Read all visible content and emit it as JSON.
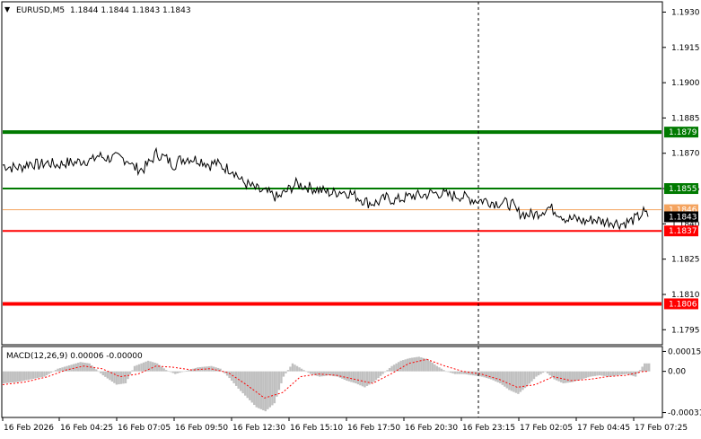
{
  "header": {
    "symbol_label": "EURUSD,M5",
    "ohlc": "1.1844 1.1844 1.1843 1.1843"
  },
  "colors": {
    "price_line": "#000000",
    "support_resistance_green": "#007a00",
    "support_resistance_red": "#ff0000",
    "bid_line": "#f4a460",
    "macd_histogram": "#c0c0c0",
    "macd_signal": "#ff0000",
    "axis_frame": "#000000",
    "crosshair": "#000000"
  },
  "chart_data": [
    {
      "type": "line",
      "panel": "main-price",
      "title": "EURUSD,M5",
      "ylim": [
        1.1789,
        1.1934
      ],
      "y_ticks": [
        "1.1930",
        "1.1915",
        "1.1900",
        "1.1885",
        "1.1870",
        "1.1855",
        "1.1840",
        "1.1825",
        "1.1810",
        "1.1795"
      ],
      "y_tick_values": [
        1.193,
        1.1915,
        1.19,
        1.1885,
        1.187,
        1.1855,
        1.184,
        1.1825,
        1.181,
        1.1795
      ],
      "x_labels": [
        "16 Feb 2026",
        "16 Feb 04:25",
        "16 Feb 07:05",
        "16 Feb 09:50",
        "16 Feb 12:30",
        "16 Feb 15:10",
        "16 Feb 17:50",
        "16 Feb 20:30",
        "16 Feb 23:15",
        "17 Feb 02:05",
        "17 Feb 04:45",
        "17 Feb 07:25"
      ],
      "price_points": [
        [
          0,
          1.1865
        ],
        [
          2,
          1.1864
        ],
        [
          4,
          1.1864
        ],
        [
          6,
          1.1866
        ],
        [
          8,
          1.1865
        ],
        [
          10,
          1.1866
        ],
        [
          12,
          1.1865
        ],
        [
          14,
          1.1866
        ],
        [
          16,
          1.1866
        ],
        [
          18,
          1.1867
        ],
        [
          20,
          1.1867
        ],
        [
          21,
          1.1869
        ],
        [
          23,
          1.1868
        ],
        [
          26,
          1.1868
        ],
        [
          28,
          1.1867
        ],
        [
          29,
          1.1864
        ],
        [
          31,
          1.1863
        ],
        [
          33,
          1.1867
        ],
        [
          34,
          1.187
        ],
        [
          36,
          1.1868
        ],
        [
          38,
          1.1865
        ],
        [
          39,
          1.1867
        ],
        [
          41,
          1.1868
        ],
        [
          44,
          1.1867
        ],
        [
          46,
          1.1865
        ],
        [
          47,
          1.1866
        ],
        [
          49,
          1.1864
        ],
        [
          51,
          1.1863
        ],
        [
          53,
          1.1858
        ],
        [
          55,
          1.1856
        ],
        [
          57,
          1.1854
        ],
        [
          59,
          1.1853
        ],
        [
          61,
          1.1851
        ],
        [
          63,
          1.1854
        ],
        [
          65,
          1.1857
        ],
        [
          67,
          1.1856
        ],
        [
          69,
          1.1855
        ],
        [
          71,
          1.1854
        ],
        [
          73,
          1.1853
        ],
        [
          75,
          1.1854
        ],
        [
          77,
          1.1853
        ],
        [
          79,
          1.1851
        ],
        [
          81,
          1.1849
        ],
        [
          83,
          1.1849
        ],
        [
          85,
          1.1851
        ],
        [
          87,
          1.185
        ],
        [
          89,
          1.1851
        ],
        [
          91,
          1.1852
        ],
        [
          93,
          1.1852
        ],
        [
          95,
          1.1853
        ],
        [
          97,
          1.1853
        ],
        [
          99,
          1.1852
        ],
        [
          101,
          1.1852
        ],
        [
          103,
          1.1851
        ],
        [
          105,
          1.185
        ],
        [
          107,
          1.185
        ],
        [
          109,
          1.1849
        ],
        [
          111,
          1.1849
        ],
        [
          113,
          1.1848
        ],
        [
          114,
          1.1845
        ],
        [
          116,
          1.1844
        ],
        [
          118,
          1.1844
        ],
        [
          119,
          1.1845
        ],
        [
          121,
          1.1847
        ],
        [
          123,
          1.1845
        ],
        [
          125,
          1.1842
        ],
        [
          127,
          1.1842
        ],
        [
          129,
          1.1841
        ],
        [
          131,
          1.1842
        ],
        [
          133,
          1.1841
        ],
        [
          135,
          1.1841
        ],
        [
          137,
          1.184
        ],
        [
          139,
          1.1841
        ],
        [
          141,
          1.1843
        ],
        [
          142,
          1.1845
        ],
        [
          143,
          1.1843
        ]
      ],
      "horizontal_levels": [
        {
          "value": 1.1879,
          "label": "1.1879",
          "color": "#007a00",
          "weight": "thick"
        },
        {
          "value": 1.1855,
          "label": "1.1855",
          "color": "#007a00",
          "weight": "thin"
        },
        {
          "value": 1.1846,
          "label": "1.1846",
          "color": "#f4a460",
          "weight": "hair"
        },
        {
          "value": 1.1843,
          "label": "1.1843",
          "color": "#000000",
          "weight": "current"
        },
        {
          "value": 1.1837,
          "label": "1.1837",
          "color": "#ff0000",
          "weight": "thin"
        },
        {
          "value": 1.1806,
          "label": "1.1806",
          "color": "#ff0000",
          "weight": "thick"
        }
      ],
      "grid": false
    },
    {
      "type": "bar",
      "panel": "macd",
      "title": "MACD(12,26,9) 0.00006 -0.00000",
      "ylim": [
        -0.00034,
        0.00018
      ],
      "y_ticks": [
        "0.00015",
        "0.00",
        "-0.00031"
      ],
      "y_tick_values": [
        0.00015,
        0.0,
        -0.00031
      ],
      "macd_points": [
        [
          0,
          -9e-05
        ],
        [
          3,
          -8e-05
        ],
        [
          6,
          -6e-05
        ],
        [
          9,
          -4e-05
        ],
        [
          12,
          2e-05
        ],
        [
          15,
          5e-05
        ],
        [
          17,
          7e-05
        ],
        [
          19,
          6e-05
        ],
        [
          22,
          -3e-05
        ],
        [
          25,
          -0.0001
        ],
        [
          27,
          -9e-05
        ],
        [
          29,
          4e-05
        ],
        [
          32,
          8e-05
        ],
        [
          34,
          6e-05
        ],
        [
          36,
          1e-05
        ],
        [
          38,
          -2e-05
        ],
        [
          40,
          0.0
        ],
        [
          43,
          3e-05
        ],
        [
          46,
          4e-05
        ],
        [
          48,
          2e-05
        ],
        [
          50,
          -5e-05
        ],
        [
          52,
          -0.00013
        ],
        [
          54,
          -0.0002
        ],
        [
          56,
          -0.00027
        ],
        [
          58,
          -0.0003
        ],
        [
          60,
          -0.00024
        ],
        [
          62,
          -4e-05
        ],
        [
          64,
          6e-05
        ],
        [
          66,
          2e-05
        ],
        [
          68,
          -2e-05
        ],
        [
          70,
          -4e-05
        ],
        [
          72,
          -3e-05
        ],
        [
          74,
          -4e-05
        ],
        [
          76,
          -7e-05
        ],
        [
          78,
          -9e-05
        ],
        [
          80,
          -0.00012
        ],
        [
          82,
          -8e-05
        ],
        [
          84,
          -2e-05
        ],
        [
          86,
          4e-05
        ],
        [
          88,
          8e-05
        ],
        [
          90,
          0.0001
        ],
        [
          92,
          0.00011
        ],
        [
          94,
          9e-05
        ],
        [
          96,
          4e-05
        ],
        [
          98,
          0.0
        ],
        [
          100,
          -2e-05
        ],
        [
          102,
          -2e-05
        ],
        [
          104,
          -3e-05
        ],
        [
          106,
          -4e-05
        ],
        [
          108,
          -6e-05
        ],
        [
          110,
          -9e-05
        ],
        [
          112,
          -0.00014
        ],
        [
          114,
          -0.00017
        ],
        [
          116,
          -0.00011
        ],
        [
          118,
          -4e-05
        ],
        [
          120,
          0.0
        ],
        [
          122,
          -6e-05
        ],
        [
          124,
          -9e-05
        ],
        [
          126,
          -8e-05
        ],
        [
          128,
          -6e-05
        ],
        [
          130,
          -4e-05
        ],
        [
          132,
          -3e-05
        ],
        [
          134,
          -4e-05
        ],
        [
          136,
          -3e-05
        ],
        [
          138,
          -2e-05
        ],
        [
          140,
          -4e-05
        ],
        [
          142,
          6e-05
        ]
      ],
      "signal_points": [
        [
          0,
          -0.0001
        ],
        [
          5,
          -8e-05
        ],
        [
          10,
          -4e-05
        ],
        [
          14,
          1e-05
        ],
        [
          18,
          4e-05
        ],
        [
          22,
          2e-05
        ],
        [
          26,
          -4e-05
        ],
        [
          30,
          -2e-05
        ],
        [
          34,
          4e-05
        ],
        [
          38,
          3e-05
        ],
        [
          42,
          1e-05
        ],
        [
          46,
          2e-05
        ],
        [
          50,
          -1e-05
        ],
        [
          54,
          -0.0001
        ],
        [
          58,
          -0.0002
        ],
        [
          62,
          -0.00016
        ],
        [
          66,
          -4e-05
        ],
        [
          70,
          -2e-05
        ],
        [
          74,
          -3e-05
        ],
        [
          78,
          -6e-05
        ],
        [
          82,
          -9e-05
        ],
        [
          86,
          -2e-05
        ],
        [
          90,
          6e-05
        ],
        [
          94,
          9e-05
        ],
        [
          98,
          4e-05
        ],
        [
          102,
          0.0
        ],
        [
          106,
          -2e-05
        ],
        [
          110,
          -6e-05
        ],
        [
          114,
          -0.00012
        ],
        [
          118,
          -0.0001
        ],
        [
          122,
          -4e-05
        ],
        [
          126,
          -7e-05
        ],
        [
          130,
          -6e-05
        ],
        [
          134,
          -4e-05
        ],
        [
          138,
          -3e-05
        ],
        [
          142,
          -0.0
        ]
      ]
    }
  ]
}
